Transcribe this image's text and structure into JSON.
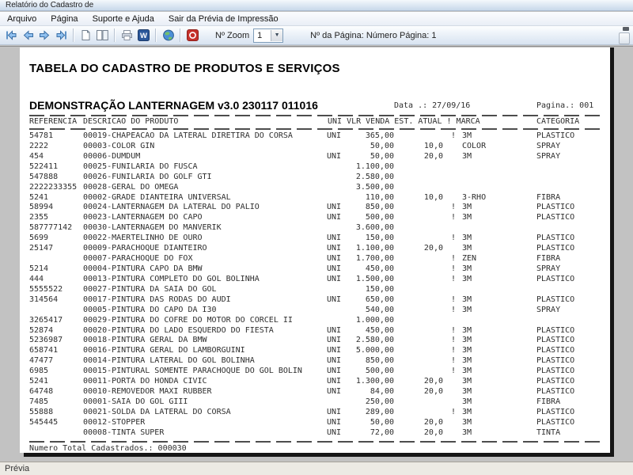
{
  "window": {
    "title": "Relatório do Cadastro de",
    "menu": [
      "Arquivo",
      "Página",
      "Suporte e Ajuda",
      "Sair da Prévia de Impressão"
    ],
    "toolbar": {
      "buttons": [
        "first-page",
        "previous-page",
        "next-page",
        "last-page",
        "single-page-view",
        "two-page-view",
        "print",
        "export-word",
        "web-help",
        "exit-preview",
        "toolbar-overflow"
      ],
      "zoom_label": "Nº Zoom",
      "zoom_value": "1",
      "page_info": "Nº da Página: Número Página: 1"
    },
    "status": "Prévia"
  },
  "report": {
    "title": "TABELA DO CADASTRO DE PRODUTOS E SERVIÇOS",
    "subtitle": "DEMONSTRAÇÃO LANTERNAGEM v3.0 230117 011016",
    "date": "Data .: 27/09/16",
    "page": "Pagina.: 001",
    "headers": {
      "referencia": "REFERENCIA",
      "descricao": "DESCRICAO DO PRODUTO",
      "meio": "UNI VLR VENDA EST. ATUAL ! MARCA",
      "categoria": "CATEGORIA"
    },
    "rows": [
      {
        "ref": "54781",
        "desc": "00019-CHAPEACAO DA LATERAL DIRETIRA DO CORSA",
        "uni": "UNI",
        "vlr": "365,00",
        "est": "",
        "flag": "!",
        "marca": "3M",
        "cat": "PLASTICO"
      },
      {
        "ref": "2222",
        "desc": "00003-COLOR GIN",
        "uni": "",
        "vlr": "50,00",
        "est": "10,0",
        "flag": "",
        "marca": "COLOR",
        "cat": "SPRAY"
      },
      {
        "ref": "454",
        "desc": "00006-DUMDUM",
        "uni": "UNI",
        "vlr": "50,00",
        "est": "20,0",
        "flag": "",
        "marca": "3M",
        "cat": "SPRAY"
      },
      {
        "ref": "522411",
        "desc": "00025-FUNILARIA DO FUSCA",
        "uni": "",
        "vlr": "1.100,00",
        "est": "",
        "flag": "",
        "marca": "",
        "cat": ""
      },
      {
        "ref": "547888",
        "desc": "00026-FUNILARIA DO GOLF GTI",
        "uni": "",
        "vlr": "2.580,00",
        "est": "",
        "flag": "",
        "marca": "",
        "cat": ""
      },
      {
        "ref": "2222233355",
        "desc": "00028-GERAL DO OMEGA",
        "uni": "",
        "vlr": "3.500,00",
        "est": "",
        "flag": "",
        "marca": "",
        "cat": ""
      },
      {
        "ref": "5241",
        "desc": "00002-GRADE DIANTEIRA UNIVERSAL",
        "uni": "",
        "vlr": "110,00",
        "est": "10,0",
        "flag": "",
        "marca": "3-RHO",
        "cat": "FIBRA"
      },
      {
        "ref": "58994",
        "desc": "00024-LANTERNAGEM DA LATERAL DO PALIO",
        "uni": "UNI",
        "vlr": "850,00",
        "est": "",
        "flag": "!",
        "marca": "3M",
        "cat": "PLASTICO"
      },
      {
        "ref": "2355",
        "desc": "00023-LANTERNAGEM DO CAPO",
        "uni": "UNI",
        "vlr": "500,00",
        "est": "",
        "flag": "!",
        "marca": "3M",
        "cat": "PLASTICO"
      },
      {
        "ref": "587777142",
        "desc": "00030-LANTERNAGEM DO MANVERIK",
        "uni": "",
        "vlr": "3.600,00",
        "est": "",
        "flag": "",
        "marca": "",
        "cat": ""
      },
      {
        "ref": "5699",
        "desc": "00022-MAERTELINHO DE OURO",
        "uni": "UNI",
        "vlr": "150,00",
        "est": "",
        "flag": "!",
        "marca": "3M",
        "cat": "PLASTICO"
      },
      {
        "ref": "25147",
        "desc": "00009-PARACHOQUE DIANTEIRO",
        "uni": "UNI",
        "vlr": "1.100,00",
        "est": "20,0",
        "flag": "",
        "marca": "3M",
        "cat": "PLASTICO"
      },
      {
        "ref": "",
        "desc": "00007-PARACHOQUE DO FOX",
        "uni": "UNI",
        "vlr": "1.700,00",
        "est": "",
        "flag": "!",
        "marca": "ZEN",
        "cat": "FIBRA"
      },
      {
        "ref": "5214",
        "desc": "00004-PINTURA CAPO DA BMW",
        "uni": "UNI",
        "vlr": "450,00",
        "est": "",
        "flag": "!",
        "marca": "3M",
        "cat": "SPRAY"
      },
      {
        "ref": "444",
        "desc": "00013-PINTURA COMPLETO DO GOL BOLINHA",
        "uni": "UNI",
        "vlr": "1.500,00",
        "est": "",
        "flag": "!",
        "marca": "3M",
        "cat": "PLASTICO"
      },
      {
        "ref": "5555522",
        "desc": "00027-PINTURA DA SAIA DO GOL",
        "uni": "",
        "vlr": "150,00",
        "est": "",
        "flag": "",
        "marca": "",
        "cat": ""
      },
      {
        "ref": "314564",
        "desc": "00017-PINTURA DAS RODAS DO AUDI",
        "uni": "UNI",
        "vlr": "650,00",
        "est": "",
        "flag": "!",
        "marca": "3M",
        "cat": "PLASTICO"
      },
      {
        "ref": "",
        "desc": "00005-PINTURA DO CAPO DA I30",
        "uni": "",
        "vlr": "540,00",
        "est": "",
        "flag": "!",
        "marca": "3M",
        "cat": "SPRAY"
      },
      {
        "ref": "3265417",
        "desc": "00029-PINTURA DO COFRE DO MOTOR DO CORCEL II",
        "uni": "",
        "vlr": "1.000,00",
        "est": "",
        "flag": "",
        "marca": "",
        "cat": ""
      },
      {
        "ref": "52874",
        "desc": "00020-PINTURA DO LADO ESQUERDO DO FIESTA",
        "uni": "UNI",
        "vlr": "450,00",
        "est": "",
        "flag": "!",
        "marca": "3M",
        "cat": "PLASTICO"
      },
      {
        "ref": "5236987",
        "desc": "00018-PINTURA GERAL DA BMW",
        "uni": "UNI",
        "vlr": "2.580,00",
        "est": "",
        "flag": "!",
        "marca": "3M",
        "cat": "PLASTICO"
      },
      {
        "ref": "658741",
        "desc": "00016-PINTURA GERAL DO LAMBORGUINI",
        "uni": "UNI",
        "vlr": "5.000,00",
        "est": "",
        "flag": "!",
        "marca": "3M",
        "cat": "PLASTICO"
      },
      {
        "ref": "47477",
        "desc": "00014-PINTURA LATERAL DO GOL BOLINHA",
        "uni": "UNI",
        "vlr": "850,00",
        "est": "",
        "flag": "!",
        "marca": "3M",
        "cat": "PLASTICO"
      },
      {
        "ref": "6985",
        "desc": "00015-PINTURAL SOMENTE PARACHOQUE DO GOL BOLIN",
        "uni": "UNI",
        "vlr": "500,00",
        "est": "",
        "flag": "!",
        "marca": "3M",
        "cat": "PLASTICO"
      },
      {
        "ref": "5241",
        "desc": "00011-PORTA DO HONDA CIVIC",
        "uni": "UNI",
        "vlr": "1.300,00",
        "est": "20,0",
        "flag": "",
        "marca": "3M",
        "cat": "PLASTICO"
      },
      {
        "ref": "64748",
        "desc": "00010-REMOVEDOR  MAXI RUBBER",
        "uni": "UNI",
        "vlr": "84,00",
        "est": "20,0",
        "flag": "",
        "marca": "3M",
        "cat": "PLASTICO"
      },
      {
        "ref": "7485",
        "desc": "00001-SAIA DO GOL GIII",
        "uni": "",
        "vlr": "250,00",
        "est": "",
        "flag": "",
        "marca": "3M",
        "cat": "FIBRA"
      },
      {
        "ref": "55888",
        "desc": "00021-SOLDA DA LATERAL DO CORSA",
        "uni": "UNI",
        "vlr": "289,00",
        "est": "",
        "flag": "!",
        "marca": "3M",
        "cat": "PLASTICO"
      },
      {
        "ref": "545445",
        "desc": "00012-STOPPER",
        "uni": "UNI",
        "vlr": "50,00",
        "est": "20,0",
        "flag": "",
        "marca": "3M",
        "cat": "PLASTICO"
      },
      {
        "ref": "",
        "desc": "00008-TINTA SUPER",
        "uni": "UNI",
        "vlr": "72,00",
        "est": "20,0",
        "flag": "",
        "marca": "3M",
        "cat": "TINTA"
      }
    ],
    "footer": "Numero Total Cadastrados.: 000030"
  },
  "colors": {
    "toolbar_arrow_blue": "#8fc0ef",
    "word_blue": "#2b579a",
    "exit_red": "#c5312b",
    "page_shadow": "#161616"
  }
}
